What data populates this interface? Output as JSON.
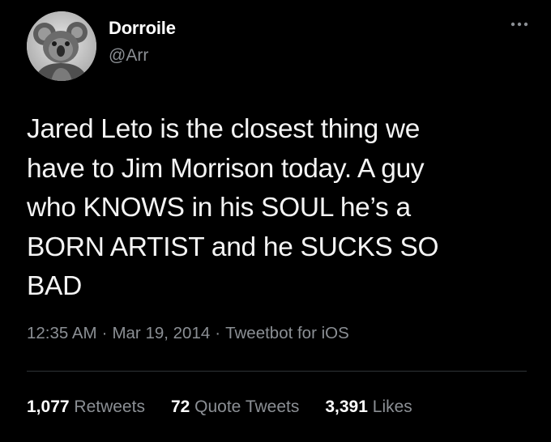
{
  "author": {
    "display_name": "Dorroile",
    "handle": "@Arr"
  },
  "icons": {
    "avatar": "koala-avatar",
    "more": "more-horizontal-icon"
  },
  "tweet": {
    "text": "Jared Leto is the closest thing we\nhave to Jim Morrison today. A guy\nwho KNOWS in his SOUL he’s a\nBORN ARTIST and he SUCKS SO\nBAD"
  },
  "meta": {
    "time": "12:35 AM",
    "separator": "·",
    "date": "Mar 19, 2014",
    "source": "Tweetbot for iOS"
  },
  "stats": {
    "retweets": {
      "count": "1,077",
      "label": "Retweets"
    },
    "quotes": {
      "count": "72",
      "label": "Quote Tweets"
    },
    "likes": {
      "count": "3,391",
      "label": "Likes"
    }
  },
  "colors": {
    "background": "#000000",
    "primary_text": "#ffffff",
    "secondary_text": "#8b8f94",
    "divider": "#2f3336"
  }
}
